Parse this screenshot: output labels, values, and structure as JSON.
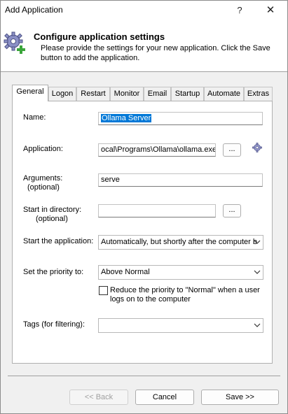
{
  "window": {
    "title": "Add Application",
    "help_label": "?",
    "close_label": "✕"
  },
  "header": {
    "title": "Configure application settings",
    "description": "Please provide the settings for your new application. Click the Save button to add the application.",
    "icon": "gear-add-icon"
  },
  "tabs": [
    {
      "label": "General",
      "active": true
    },
    {
      "label": "Logon"
    },
    {
      "label": "Restart"
    },
    {
      "label": "Monitor"
    },
    {
      "label": "Email"
    },
    {
      "label": "Startup"
    },
    {
      "label": "Automate"
    },
    {
      "label": "Extras"
    }
  ],
  "form": {
    "name_label": "Name:",
    "name_value": "Ollama Server",
    "application_label": "Application:",
    "application_value": "ocal\\Programs\\Ollama\\ollama.exe",
    "browse_label": "...",
    "arguments_label": "Arguments:",
    "arguments_optional": "(optional)",
    "arguments_value": "serve",
    "start_dir_label": "Start in directory:",
    "start_dir_optional": "(optional)",
    "start_dir_value": "",
    "start_app_label": "Start the application:",
    "start_app_value": "Automatically, but shortly after the computer b",
    "priority_label": "Set the priority to:",
    "priority_value": "Above Normal",
    "reduce_priority_label": "Reduce the priority to \"Normal\" when a user logs on to the computer",
    "reduce_priority_checked": false,
    "tags_label": "Tags (for filtering):",
    "tags_value": ""
  },
  "buttons": {
    "back": "<< Back",
    "cancel": "Cancel",
    "save": "Save >>"
  },
  "colors": {
    "accent": "#0078d7",
    "gear": "#7a7fb8",
    "plus": "#3aa53a"
  }
}
